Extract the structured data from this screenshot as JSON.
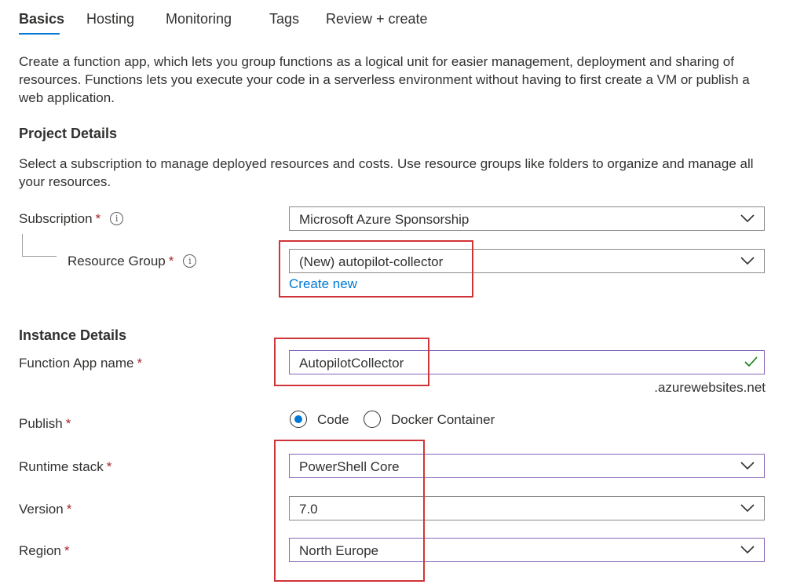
{
  "tabs": [
    {
      "label": "Basics",
      "active": true
    },
    {
      "label": "Hosting",
      "active": false
    },
    {
      "label": "Monitoring",
      "active": false
    },
    {
      "label": "Tags",
      "active": false
    },
    {
      "label": "Review + create",
      "active": false
    }
  ],
  "intro": "Create a function app, which lets you group functions as a logical unit for easier management, deployment and sharing of resources. Functions lets you execute your code in a serverless environment without having to first create a VM or publish a web application.",
  "project": {
    "heading": "Project Details",
    "description": "Select a subscription to manage deployed resources and costs. Use resource groups like folders to organize and manage all your resources.",
    "subscription_label": "Subscription",
    "subscription_value": "Microsoft Azure Sponsorship",
    "resource_group_label": "Resource Group",
    "resource_group_value": "(New) autopilot-collector",
    "create_new": "Create new"
  },
  "instance": {
    "heading": "Instance Details",
    "app_name_label": "Function App name",
    "app_name_value": "AutopilotCollector",
    "domain_suffix": ".azurewebsites.net",
    "publish_label": "Publish",
    "publish_options": [
      "Code",
      "Docker Container"
    ],
    "publish_selected": "Code",
    "runtime_label": "Runtime stack",
    "runtime_value": "PowerShell Core",
    "version_label": "Version",
    "version_value": "7.0",
    "region_label": "Region",
    "region_value": "North Europe"
  },
  "required_marker": "*",
  "info_glyph": "i",
  "colors": {
    "accent": "#0078d4",
    "required": "#a4262c",
    "highlight": "#d13438",
    "valid": "#107c10",
    "focus_border": "#8764b8"
  }
}
